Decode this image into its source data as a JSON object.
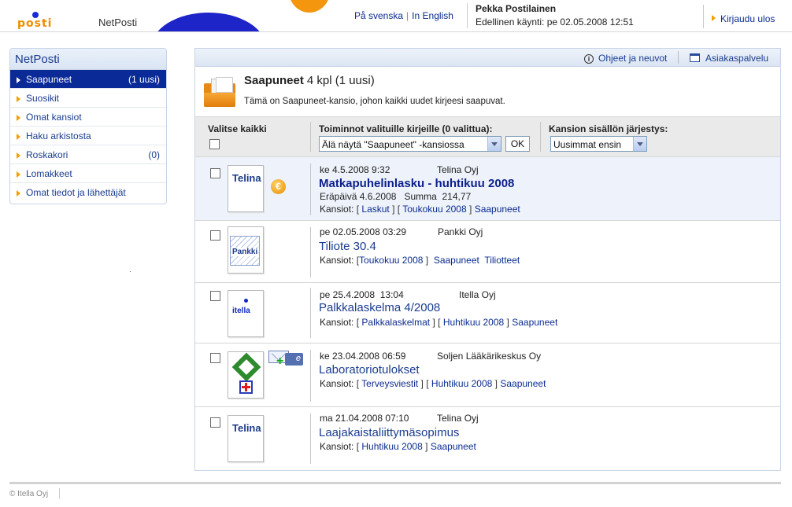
{
  "header": {
    "logo_text": "posti",
    "app_name": "NetPosti",
    "lang_swedish": "På svenska",
    "lang_english": "In English",
    "lang_sep": "|",
    "user_name": "Pekka Postilainen",
    "last_visit": "Edellinen käynti: pe 02.05.2008 12:51",
    "logout": "Kirjaudu ulos"
  },
  "sidebar": {
    "title": "NetPosti",
    "items": [
      {
        "label": "Saapuneet",
        "count": "(1 uusi)",
        "active": true
      },
      {
        "label": "Suosikit",
        "count": ""
      },
      {
        "label": "Omat kansiot",
        "count": ""
      },
      {
        "label": "Haku arkistosta",
        "count": ""
      },
      {
        "label": "Roskakori",
        "count": "(0)"
      },
      {
        "label": "Lomakkeet",
        "count": ""
      },
      {
        "label": "Omat tiedot ja lähettäjät",
        "count": ""
      }
    ]
  },
  "toolbar": {
    "help": "Ohjeet ja neuvot",
    "support": "Asiakaspalvelu"
  },
  "folder": {
    "name": "Saapuneet",
    "count": "4 kpl (1 uusi)",
    "description": "Tämä on Saapuneet-kansio, johon kaikki uudet kirjeesi saapuvat."
  },
  "controls": {
    "select_all": "Valitse kaikki",
    "actions_label": "Toiminnot valituille kirjeille (0 valittua):",
    "actions_selected": "Älä näytä \"Saapuneet\" -kansiossa",
    "ok": "OK",
    "sort_label": "Kansion sisällön järjestys:",
    "sort_selected": "Uusimmat ensin"
  },
  "messages": [
    {
      "date": "ke 4.5.2008 9:32",
      "sender": "Telina Oyj",
      "subject": "Matkapuhelinlasku - huhtikuu 2008",
      "due_label": "Eräpäivä",
      "due": "4.6.2008",
      "sum_label": "Summa",
      "sum": "214,77",
      "folders_label": "Kansiot:",
      "folders": [
        "Laskut",
        "Toukokuu 2008",
        "Saapuneet"
      ],
      "logo": "Telina",
      "icon": "euro-icon",
      "unread": true
    },
    {
      "date": "pe 02.05.2008 03:29",
      "sender": "Pankki Oyj",
      "subject": "Tiliote 30.4",
      "folders_label": "Kansiot:",
      "folders": [
        "Toukokuu 2008",
        "Saapuneet",
        "Tiliotteet"
      ],
      "logo": "Pankki"
    },
    {
      "date": "pe 25.4.2008",
      "time": "13:04",
      "sender": "Itella Oyj",
      "subject": "Palkkalaskelma 4/2008",
      "folders_label": "Kansiot:",
      "folders": [
        "Palkkalaskelmat",
        "Huhtikuu 2008",
        "Saapuneet"
      ],
      "logo": "itella"
    },
    {
      "date": "ke 23.04.2008 06:59",
      "sender": "Soljen Lääkärikeskus Oy",
      "subject": "Laboratoriotulokset",
      "folders_label": "Kansiot:",
      "folders": [
        "Terveysviestit",
        "Huhtikuu 2008",
        "Saapuneet"
      ],
      "icon": "e-letter-icon",
      "eletter_mark": "e"
    },
    {
      "date": "ma 21.04.2008 07:10",
      "sender": "Telina Oyj",
      "subject": "Laajakaistaliittymäsopimus",
      "folders_label": "Kansiot:",
      "folders": [
        "Huhtikuu 2008",
        "Saapuneet"
      ],
      "logo": "Telina"
    }
  ],
  "footer": {
    "copyright": "© Itella Oyj"
  },
  "colors": {
    "brand_blue": "#0a2a98",
    "brand_orange": "#f5960f",
    "link": "#0b2c8f"
  }
}
